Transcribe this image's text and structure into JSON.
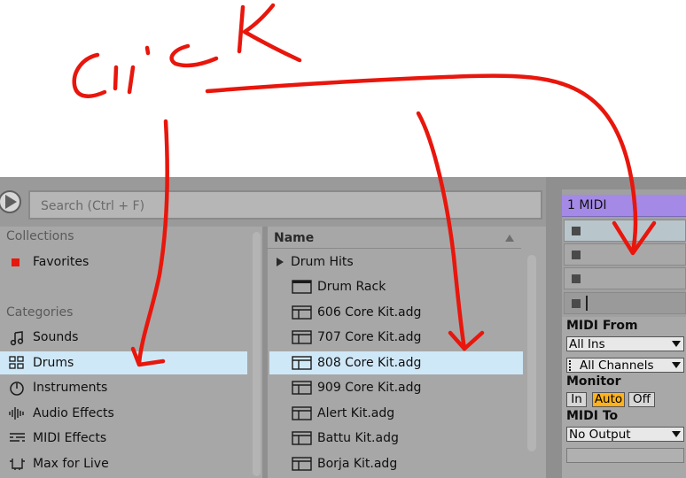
{
  "annotation": {
    "text": "click"
  },
  "toolbar": {
    "search_placeholder": "Search (Ctrl + F)"
  },
  "sidebar": {
    "collections_title": "Collections",
    "favorites_label": "Favorites",
    "favorites_color": "#e8160c",
    "categories_title": "Categories",
    "items": [
      {
        "label": "Sounds",
        "icon": "music-note-icon"
      },
      {
        "label": "Drums",
        "icon": "grid-icon",
        "selected": true
      },
      {
        "label": "Instruments",
        "icon": "instrument-knob-icon"
      },
      {
        "label": "Audio Effects",
        "icon": "audio-bars-icon"
      },
      {
        "label": "MIDI Effects",
        "icon": "midi-lines-icon"
      },
      {
        "label": "Max for Live",
        "icon": "max-plug-icon"
      }
    ]
  },
  "list": {
    "column_name": "Name",
    "items": [
      {
        "label": "Drum Hits",
        "icon": "triangle-right-icon"
      },
      {
        "label": "Drum Rack",
        "icon": "drum-rack-icon"
      },
      {
        "label": "606 Core Kit.adg",
        "icon": "preset-icon"
      },
      {
        "label": "707 Core Kit.adg",
        "icon": "preset-icon"
      },
      {
        "label": "808 Core Kit.adg",
        "icon": "preset-icon",
        "selected": true
      },
      {
        "label": "909 Core Kit.adg",
        "icon": "preset-icon"
      },
      {
        "label": "Alert Kit.adg",
        "icon": "preset-icon"
      },
      {
        "label": "Battu Kit.adg",
        "icon": "preset-icon"
      },
      {
        "label": "Borja Kit.adg",
        "icon": "preset-icon"
      }
    ]
  },
  "track": {
    "title": "1 MIDI",
    "title_color": "#a48ae6",
    "midi_from_label": "MIDI From",
    "midi_from_value": "All Ins",
    "channel_value": "All Channels",
    "monitor_label": "Monitor",
    "monitor_options": [
      "In",
      "Auto",
      "Off"
    ],
    "monitor_active": "Auto",
    "monitor_active_color": "#ffb21a",
    "midi_to_label": "MIDI To",
    "midi_to_value": "No Output"
  },
  "colors": {
    "selection": "#cfe8f8",
    "ink": "#e8160c"
  }
}
